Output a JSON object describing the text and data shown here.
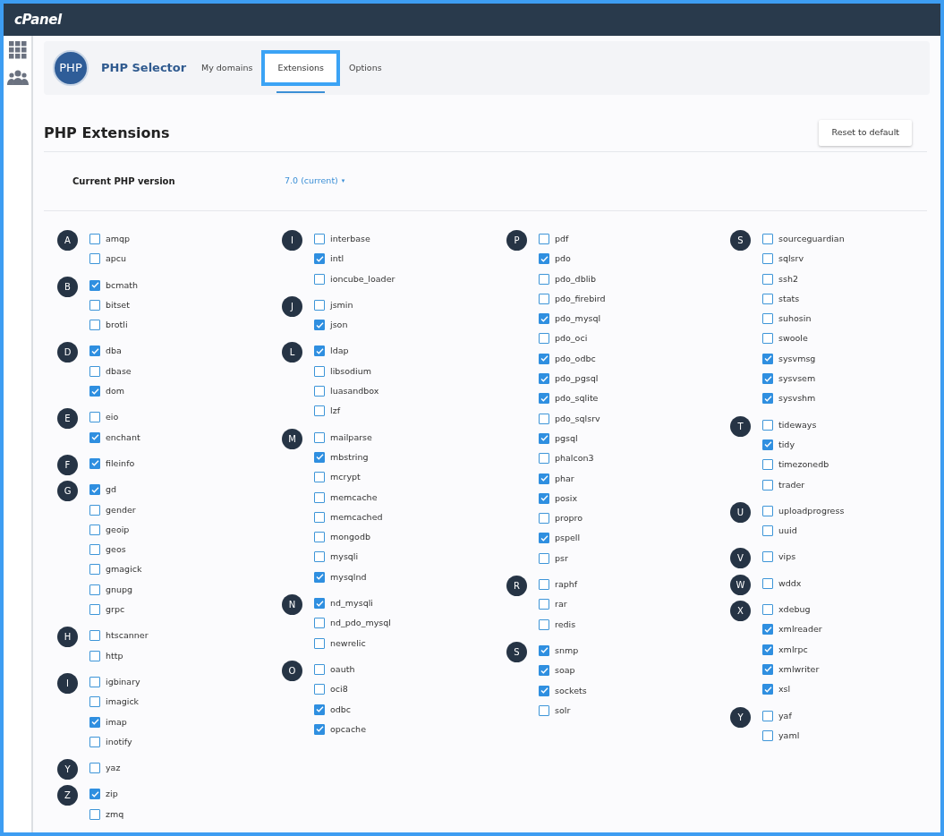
{
  "brand": "cPanel",
  "app": {
    "title": "PHP Selector",
    "logo_text": "PHP"
  },
  "tabs": [
    {
      "label": "My domains",
      "selected": false
    },
    {
      "label": "Extensions",
      "selected": true
    },
    {
      "label": "Options",
      "selected": false
    }
  ],
  "section": {
    "title": "PHP Extensions",
    "reset_button": "Reset to default"
  },
  "version": {
    "label": "Current PHP version",
    "value": "7.0 (current)",
    "caret": "▾"
  },
  "columns": [
    {
      "groups": [
        {
          "letter": "A",
          "extensions": [
            {
              "name": "amqp",
              "checked": false
            },
            {
              "name": "apcu",
              "checked": false
            }
          ]
        },
        {
          "letter": "B",
          "extensions": [
            {
              "name": "bcmath",
              "checked": true
            },
            {
              "name": "bitset",
              "checked": false
            },
            {
              "name": "brotli",
              "checked": false
            }
          ]
        },
        {
          "letter": "D",
          "extensions": [
            {
              "name": "dba",
              "checked": true
            },
            {
              "name": "dbase",
              "checked": false
            },
            {
              "name": "dom",
              "checked": true
            }
          ]
        },
        {
          "letter": "E",
          "extensions": [
            {
              "name": "eio",
              "checked": false
            },
            {
              "name": "enchant",
              "checked": true
            }
          ]
        },
        {
          "letter": "F",
          "extensions": [
            {
              "name": "fileinfo",
              "checked": true
            }
          ]
        },
        {
          "letter": "G",
          "extensions": [
            {
              "name": "gd",
              "checked": true
            },
            {
              "name": "gender",
              "checked": false
            },
            {
              "name": "geoip",
              "checked": false
            },
            {
              "name": "geos",
              "checked": false
            },
            {
              "name": "gmagick",
              "checked": false
            },
            {
              "name": "gnupg",
              "checked": false
            },
            {
              "name": "grpc",
              "checked": false
            }
          ]
        },
        {
          "letter": "H",
          "extensions": [
            {
              "name": "htscanner",
              "checked": false
            },
            {
              "name": "http",
              "checked": false
            }
          ]
        },
        {
          "letter": "I",
          "extensions": [
            {
              "name": "igbinary",
              "checked": false
            },
            {
              "name": "imagick",
              "checked": false
            },
            {
              "name": "imap",
              "checked": true
            },
            {
              "name": "inotify",
              "checked": false
            }
          ]
        },
        {
          "letter": "Y",
          "extensions": [
            {
              "name": "yaz",
              "checked": false
            }
          ]
        },
        {
          "letter": "Z",
          "extensions": [
            {
              "name": "zip",
              "checked": true
            },
            {
              "name": "zmq",
              "checked": false
            }
          ]
        }
      ]
    },
    {
      "groups": [
        {
          "letter": "I",
          "extensions": [
            {
              "name": "interbase",
              "checked": false
            },
            {
              "name": "intl",
              "checked": true
            },
            {
              "name": "ioncube_loader",
              "checked": false
            }
          ]
        },
        {
          "letter": "J",
          "extensions": [
            {
              "name": "jsmin",
              "checked": false
            },
            {
              "name": "json",
              "checked": true
            }
          ]
        },
        {
          "letter": "L",
          "extensions": [
            {
              "name": "ldap",
              "checked": true
            },
            {
              "name": "libsodium",
              "checked": false
            },
            {
              "name": "luasandbox",
              "checked": false
            },
            {
              "name": "lzf",
              "checked": false
            }
          ]
        },
        {
          "letter": "M",
          "extensions": [
            {
              "name": "mailparse",
              "checked": false
            },
            {
              "name": "mbstring",
              "checked": true
            },
            {
              "name": "mcrypt",
              "checked": false
            },
            {
              "name": "memcache",
              "checked": false
            },
            {
              "name": "memcached",
              "checked": false
            },
            {
              "name": "mongodb",
              "checked": false
            },
            {
              "name": "mysqli",
              "checked": false
            },
            {
              "name": "mysqlnd",
              "checked": true
            }
          ]
        },
        {
          "letter": "N",
          "extensions": [
            {
              "name": "nd_mysqli",
              "checked": true
            },
            {
              "name": "nd_pdo_mysql",
              "checked": false
            },
            {
              "name": "newrelic",
              "checked": false
            }
          ]
        },
        {
          "letter": "O",
          "extensions": [
            {
              "name": "oauth",
              "checked": false
            },
            {
              "name": "oci8",
              "checked": false
            },
            {
              "name": "odbc",
              "checked": true
            },
            {
              "name": "opcache",
              "checked": true
            }
          ]
        }
      ]
    },
    {
      "groups": [
        {
          "letter": "P",
          "extensions": [
            {
              "name": "pdf",
              "checked": false
            },
            {
              "name": "pdo",
              "checked": true
            },
            {
              "name": "pdo_dblib",
              "checked": false
            },
            {
              "name": "pdo_firebird",
              "checked": false
            },
            {
              "name": "pdo_mysql",
              "checked": true
            },
            {
              "name": "pdo_oci",
              "checked": false
            },
            {
              "name": "pdo_odbc",
              "checked": true
            },
            {
              "name": "pdo_pgsql",
              "checked": true
            },
            {
              "name": "pdo_sqlite",
              "checked": true
            },
            {
              "name": "pdo_sqlsrv",
              "checked": false
            },
            {
              "name": "pgsql",
              "checked": true
            },
            {
              "name": "phalcon3",
              "checked": false
            },
            {
              "name": "phar",
              "checked": true
            },
            {
              "name": "posix",
              "checked": true
            },
            {
              "name": "propro",
              "checked": false
            },
            {
              "name": "pspell",
              "checked": true
            },
            {
              "name": "psr",
              "checked": false
            }
          ]
        },
        {
          "letter": "R",
          "extensions": [
            {
              "name": "raphf",
              "checked": false
            },
            {
              "name": "rar",
              "checked": false
            },
            {
              "name": "redis",
              "checked": false
            }
          ]
        },
        {
          "letter": "S",
          "extensions": [
            {
              "name": "snmp",
              "checked": true
            },
            {
              "name": "soap",
              "checked": true
            },
            {
              "name": "sockets",
              "checked": true
            },
            {
              "name": "solr",
              "checked": false
            }
          ]
        }
      ]
    },
    {
      "groups": [
        {
          "letter": "S",
          "extensions": [
            {
              "name": "sourceguardian",
              "checked": false
            },
            {
              "name": "sqlsrv",
              "checked": false
            },
            {
              "name": "ssh2",
              "checked": false
            },
            {
              "name": "stats",
              "checked": false
            },
            {
              "name": "suhosin",
              "checked": false
            },
            {
              "name": "swoole",
              "checked": false
            },
            {
              "name": "sysvmsg",
              "checked": true
            },
            {
              "name": "sysvsem",
              "checked": true
            },
            {
              "name": "sysvshm",
              "checked": true
            }
          ]
        },
        {
          "letter": "T",
          "extensions": [
            {
              "name": "tideways",
              "checked": false
            },
            {
              "name": "tidy",
              "checked": true
            },
            {
              "name": "timezonedb",
              "checked": false
            },
            {
              "name": "trader",
              "checked": false
            }
          ]
        },
        {
          "letter": "U",
          "extensions": [
            {
              "name": "uploadprogress",
              "checked": false
            },
            {
              "name": "uuid",
              "checked": false
            }
          ]
        },
        {
          "letter": "V",
          "extensions": [
            {
              "name": "vips",
              "checked": false
            }
          ]
        },
        {
          "letter": "W",
          "extensions": [
            {
              "name": "wddx",
              "checked": false
            }
          ]
        },
        {
          "letter": "X",
          "extensions": [
            {
              "name": "xdebug",
              "checked": false
            },
            {
              "name": "xmlreader",
              "checked": true
            },
            {
              "name": "xmlrpc",
              "checked": true
            },
            {
              "name": "xmlwriter",
              "checked": true
            },
            {
              "name": "xsl",
              "checked": true
            }
          ]
        },
        {
          "letter": "Y",
          "extensions": [
            {
              "name": "yaf",
              "checked": false
            },
            {
              "name": "yaml",
              "checked": false
            }
          ]
        }
      ]
    }
  ]
}
